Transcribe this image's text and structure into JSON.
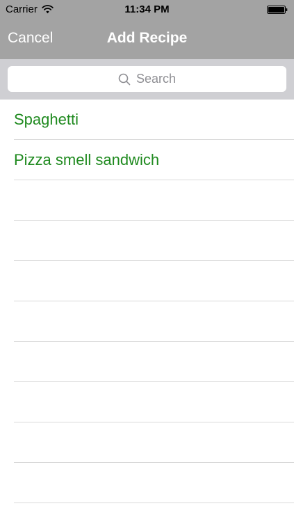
{
  "status_bar": {
    "carrier": "Carrier",
    "time": "11:34 PM",
    "wifi_icon": "wifi-icon",
    "battery_icon": "battery-icon"
  },
  "nav": {
    "cancel_label": "Cancel",
    "title": "Add Recipe"
  },
  "search": {
    "placeholder": "Search",
    "icon": "search-icon"
  },
  "recipes": [
    {
      "name": "Spaghetti"
    },
    {
      "name": "Pizza smell sandwich"
    },
    {
      "name": ""
    },
    {
      "name": ""
    },
    {
      "name": ""
    },
    {
      "name": ""
    },
    {
      "name": ""
    },
    {
      "name": ""
    },
    {
      "name": ""
    },
    {
      "name": ""
    }
  ],
  "colors": {
    "navbar": "#a3a3a3",
    "search_bar": "#cfcfd3",
    "recipe_text": "#1f8a1f",
    "separator": "#d9d9d9"
  }
}
